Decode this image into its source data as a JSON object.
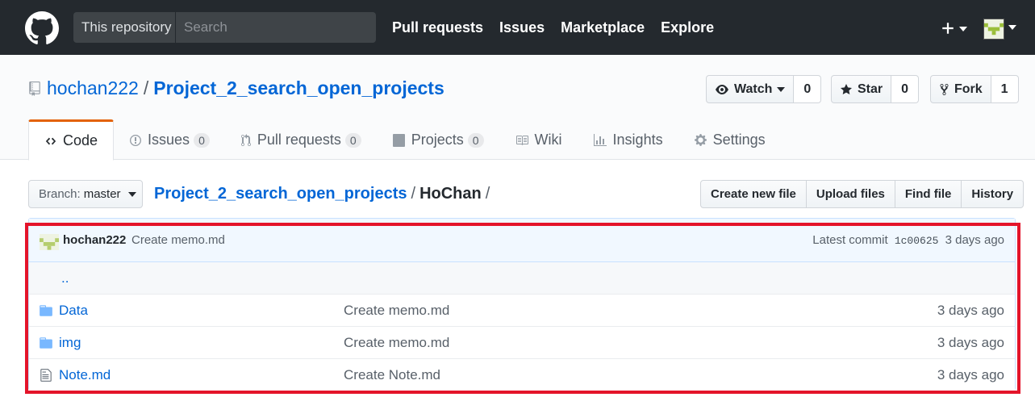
{
  "header": {
    "scope_label": "This repository",
    "search_placeholder": "Search",
    "nav": [
      "Pull requests",
      "Issues",
      "Marketplace",
      "Explore"
    ]
  },
  "repo": {
    "owner": "hochan222",
    "separator": "/",
    "name": "Project_2_search_open_projects",
    "watch_label": "Watch",
    "watch_count": "0",
    "star_label": "Star",
    "star_count": "0",
    "fork_label": "Fork",
    "fork_count": "1"
  },
  "tabs": [
    {
      "label": "Code",
      "icon": "code-icon"
    },
    {
      "label": "Issues",
      "count": "0",
      "icon": "issue-icon"
    },
    {
      "label": "Pull requests",
      "count": "0",
      "icon": "pull-request-icon"
    },
    {
      "label": "Projects",
      "count": "0",
      "icon": "project-icon"
    },
    {
      "label": "Wiki",
      "icon": "book-icon"
    },
    {
      "label": "Insights",
      "icon": "graph-icon"
    },
    {
      "label": "Settings",
      "icon": "gear-icon"
    }
  ],
  "file_nav": {
    "branch_label": "Branch:",
    "branch_value": "master",
    "path_root": "Project_2_search_open_projects",
    "path_sep": "/",
    "path_current": "HoChan",
    "path_trailing": "/",
    "buttons": [
      "Create new file",
      "Upload files",
      "Find file",
      "History"
    ]
  },
  "commit": {
    "author": "hochan222",
    "message": "Create memo.md",
    "latest_label": "Latest commit",
    "sha": "1c00625",
    "age": "3 days ago"
  },
  "files": {
    "up_label": "..",
    "rows": [
      {
        "name": "Data",
        "type": "folder",
        "message": "Create memo.md",
        "age": "3 days ago"
      },
      {
        "name": "img",
        "type": "folder",
        "message": "Create memo.md",
        "age": "3 days ago"
      },
      {
        "name": "Note.md",
        "type": "file",
        "message": "Create Note.md",
        "age": "3 days ago"
      }
    ]
  },
  "colors": {
    "header_bg": "#24292e",
    "link": "#0366d6",
    "tab_accent": "#e36209",
    "highlight": "#e4142a"
  }
}
